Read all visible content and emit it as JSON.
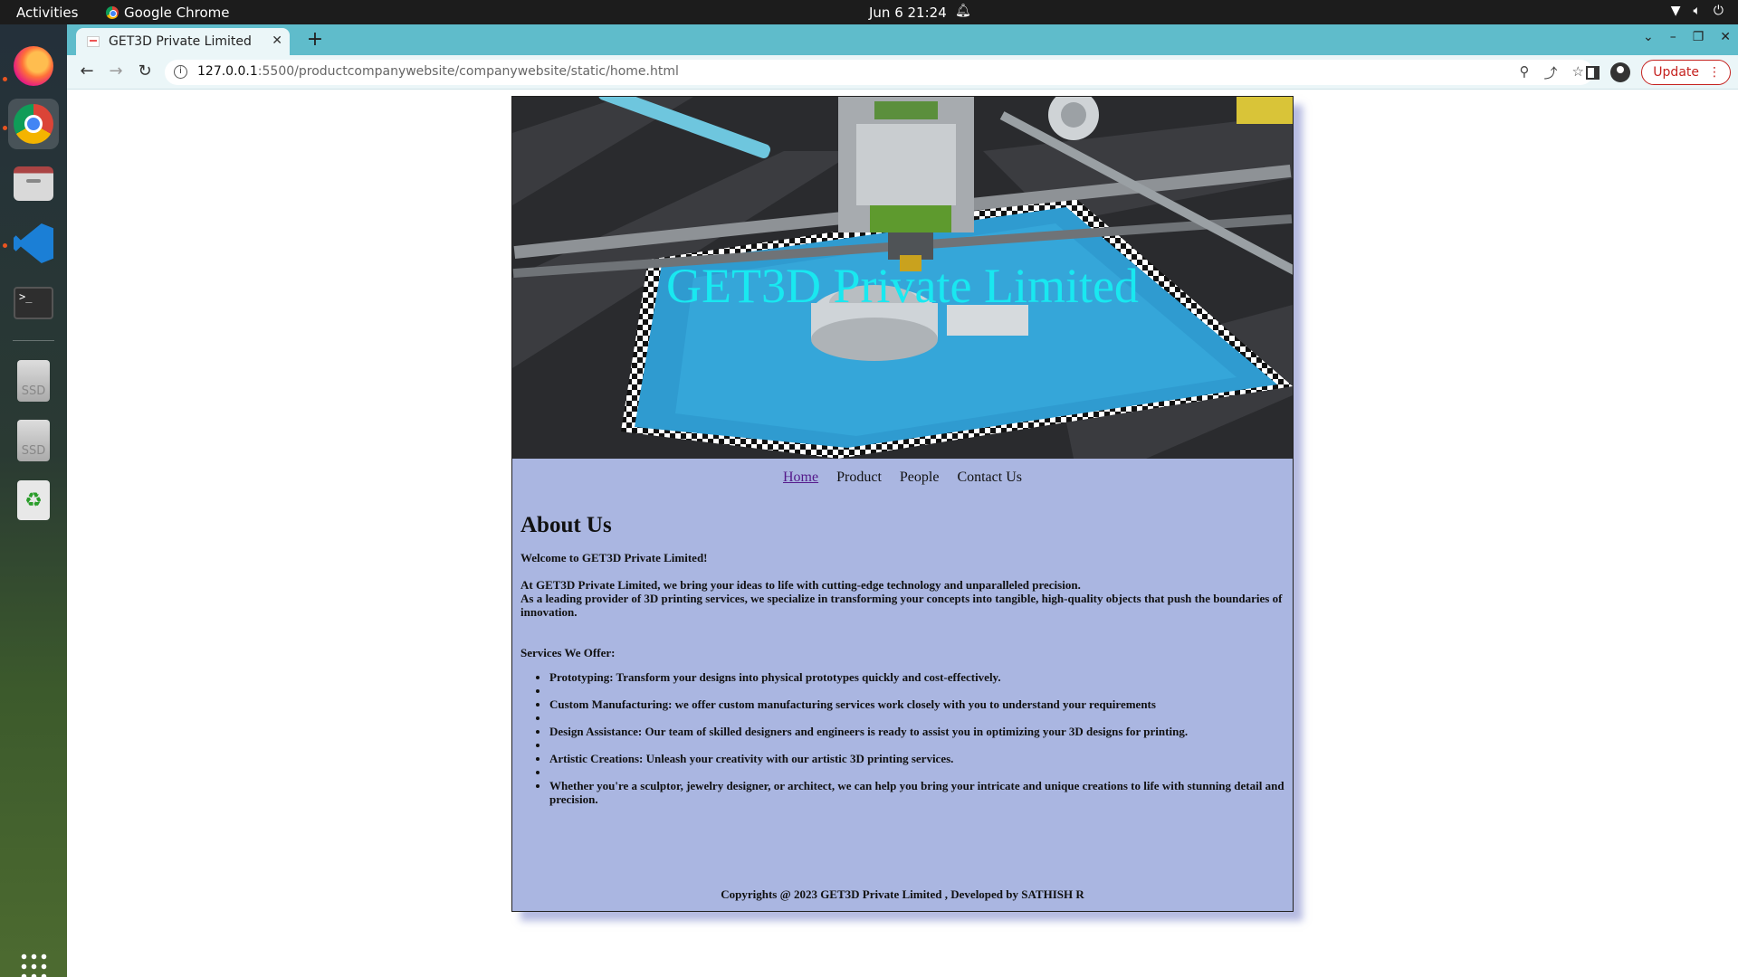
{
  "system": {
    "activities": "Activities",
    "app_name": "Google Chrome",
    "clock": "Jun 6  21:24"
  },
  "dock": {
    "items": [
      "firefox",
      "chrome",
      "files",
      "vscode",
      "terminal",
      "ssd-disk",
      "ssd-disk-2",
      "trash"
    ],
    "disk_label": "SSD"
  },
  "browser": {
    "tab_title": "GET3D Private Limited",
    "url_host": "127.0.0.1",
    "url_path": ":5500/productcompanywebsite/companywebsite/static/home.html",
    "update_label": "Update",
    "accent": "#5fbccb"
  },
  "site": {
    "hero_title": "GET3D Private Limited",
    "nav": [
      "Home",
      "Product",
      "People",
      "Contact Us"
    ],
    "about_heading": "About Us",
    "welcome": "Welcome to GET3D Private Limited!",
    "intro_1": "At GET3D Private Limited, we bring your ideas to life with cutting-edge technology and unparalleled precision.",
    "intro_2": "As a leading provider of 3D printing services, we specialize in transforming your concepts into tangible, high-quality objects that push the boundaries of innovation.",
    "services_title": "Services We Offer:",
    "services": [
      "Prototyping: Transform your designs into physical prototypes quickly and cost-effectively.",
      "",
      "Custom Manufacturing: we offer custom manufacturing services work closely with you to understand your requirements",
      "",
      "Design Assistance: Our team of skilled designers and engineers is ready to assist you in optimizing your 3D designs for printing.",
      "",
      "Artistic Creations: Unleash your creativity with our artistic 3D printing services.",
      "",
      "Whether you're a sculptor, jewelry designer, or architect, we can help you bring your intricate and unique creations to life with stunning detail and precision."
    ],
    "footer": "Copyrights @ 2023 GET3D Private Limited , Developed by SATHISH R",
    "page_bg": "#aab6e1",
    "title_color": "#19e8f0"
  }
}
